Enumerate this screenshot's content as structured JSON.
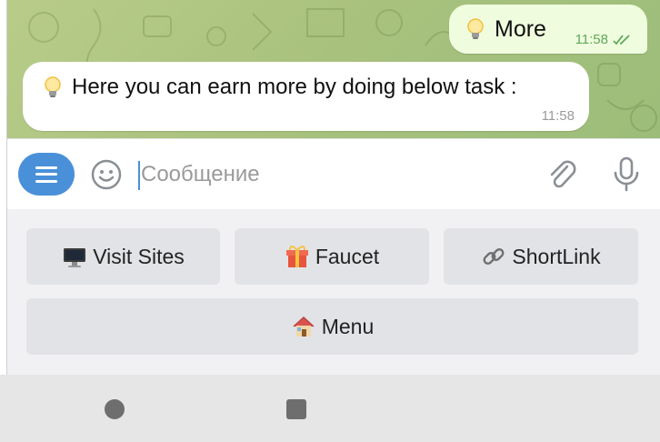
{
  "chat": {
    "outgoing": {
      "text": "More",
      "time": "11:58",
      "icon": "lightbulb-icon",
      "status_icon": "double-check-icon"
    },
    "incoming": {
      "text": "Here you can earn more by doing below task :",
      "time": "11:58",
      "icon": "lightbulb-icon"
    }
  },
  "input": {
    "placeholder": "Сообщение",
    "menu_icon": "menu-icon",
    "emoji_icon": "emoji-icon",
    "attach_icon": "paperclip-icon",
    "mic_icon": "microphone-icon"
  },
  "keyboard": {
    "buttons": [
      {
        "label": "Visit Sites",
        "icon": "computer-icon"
      },
      {
        "label": "Faucet",
        "icon": "gift-icon"
      },
      {
        "label": "ShortLink",
        "icon": "link-icon"
      },
      {
        "label": "Menu",
        "icon": "house-icon"
      }
    ]
  },
  "navbar": {
    "home_icon": "circle-home-icon",
    "recents_icon": "square-recents-icon"
  },
  "colors": {
    "accent": "#4a90d9",
    "outgoing_bubble": "#effdde",
    "check": "#5fa85a",
    "chat_bg": "#a9c27e"
  }
}
